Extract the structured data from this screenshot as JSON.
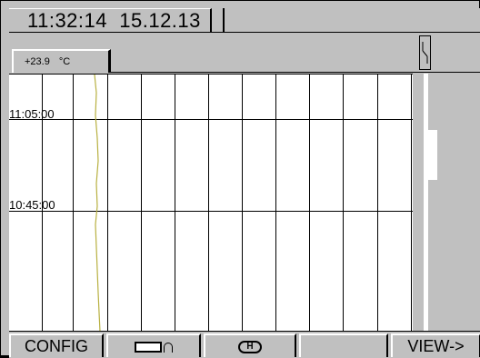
{
  "header": {
    "time": "11:32:14",
    "date": "15.12.13"
  },
  "channel": {
    "value": "+23.9",
    "unit": "°C"
  },
  "plot": {
    "time_labels": [
      "11:05:00",
      "10:45:00"
    ],
    "trace_color": "#b8b040"
  },
  "softkeys": {
    "config": "CONFIG",
    "rect_icon": "display-mode-icon",
    "h_icon": "hold-icon",
    "h_label": "H",
    "blank": "",
    "view": "VIEW->"
  }
}
